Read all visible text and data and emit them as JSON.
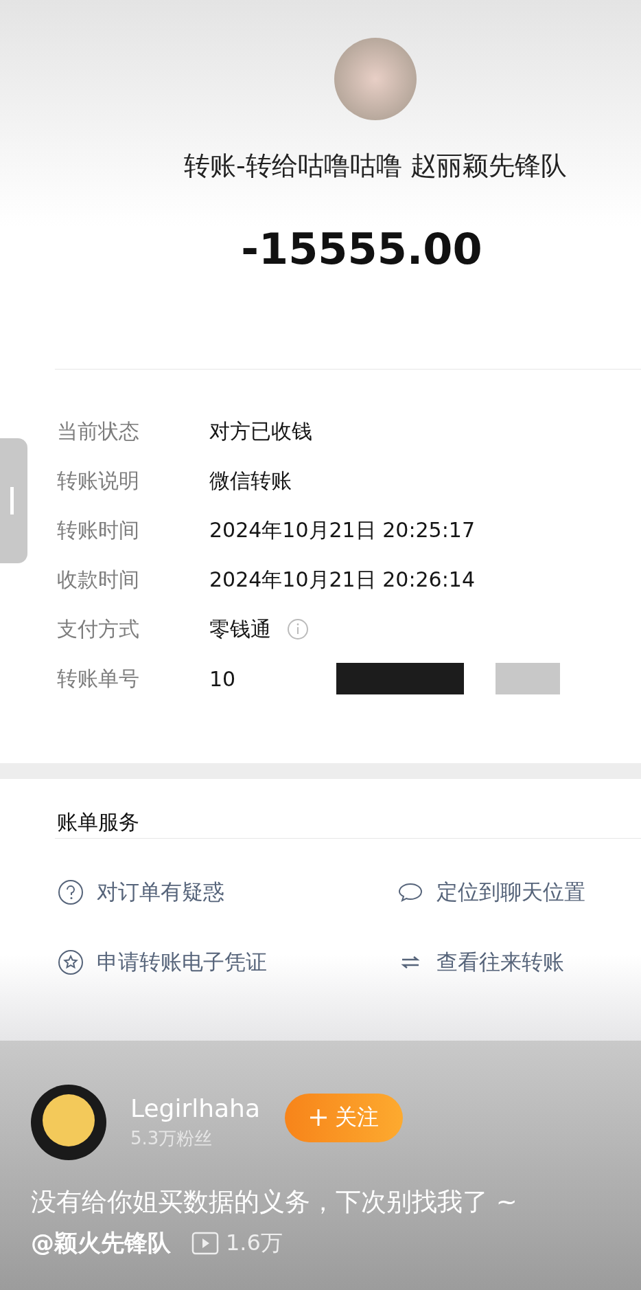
{
  "transfer": {
    "title": "转账-转给咕噜咕噜 赵丽颖先锋队",
    "amount": "-15555.00"
  },
  "details": [
    {
      "kind": "text",
      "label": "当前状态",
      "value": "对方已收钱"
    },
    {
      "kind": "text",
      "label": "转账说明",
      "value": "微信转账"
    },
    {
      "kind": "text",
      "label": "转账时间",
      "value": "2024年10月21日 20:25:17"
    },
    {
      "kind": "text",
      "label": "收款时间",
      "value": "2024年10月21日 20:26:14"
    },
    {
      "kind": "info",
      "label": "支付方式",
      "value": "零钱通"
    },
    {
      "kind": "redacted",
      "label": "转账单号",
      "value": "10"
    }
  ],
  "services": {
    "title": "账单服务",
    "items": [
      {
        "label": "对订单有疑惑"
      },
      {
        "label": "定位到聊天位置"
      },
      {
        "label": "申请转账电子凭证"
      },
      {
        "label": "查看往来转账"
      }
    ]
  },
  "post": {
    "author": "Legirlhaha",
    "followers": "5.3万粉丝",
    "follow_button": "关注",
    "caption": "没有给你姐买数据的义务，下次别找我了 ~",
    "mention": "@颖火先锋队",
    "views": "1.6万"
  }
}
